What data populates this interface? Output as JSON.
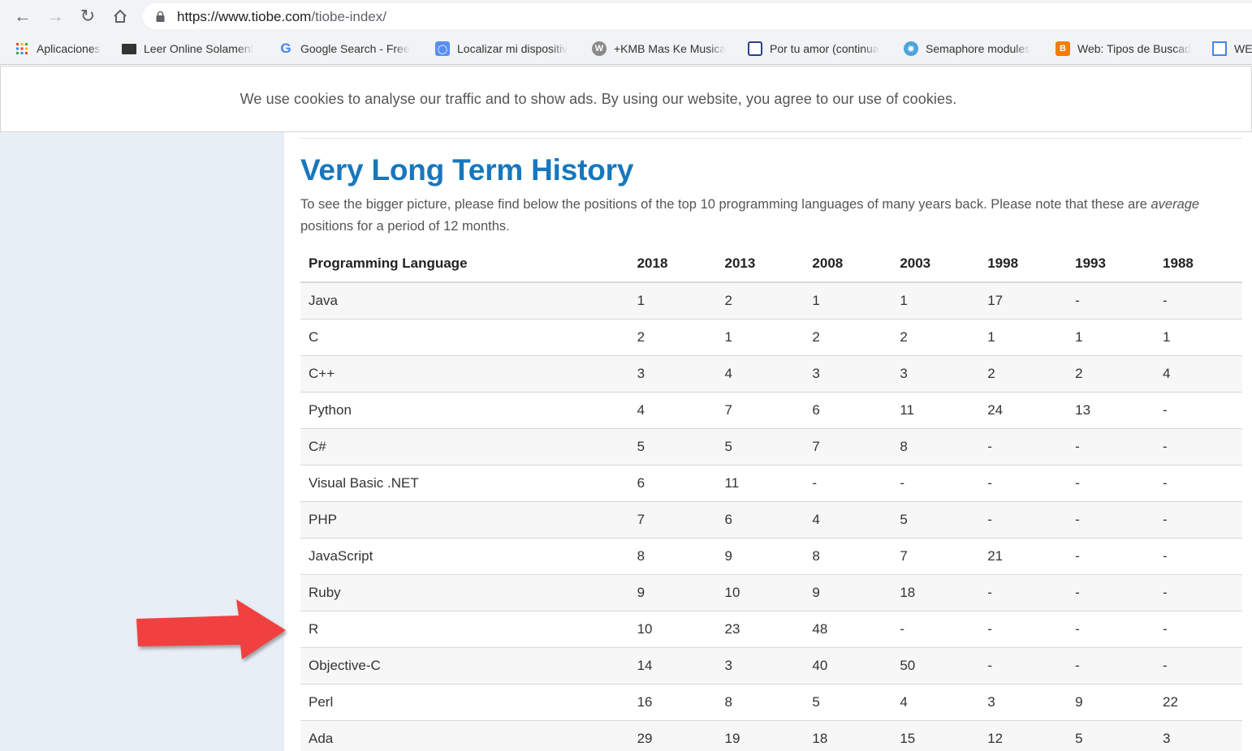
{
  "browser": {
    "url_host": "https://www.tiobe.com",
    "url_path": "/tiobe-index/",
    "bookmarks": [
      {
        "label": "Aplicaciones",
        "icon": "apps-grid-icon"
      },
      {
        "label": "Leer Online Solament",
        "icon": "laptop-icon"
      },
      {
        "label": "Google Search - Free",
        "icon": "google-icon"
      },
      {
        "label": "Localizar mi dispositiv",
        "icon": "find-device-icon"
      },
      {
        "label": "+KMB Mas Ke Musica",
        "icon": "wordpress-icon"
      },
      {
        "label": "Por tu amor (continua",
        "icon": "document-icon"
      },
      {
        "label": "Semaphore modules",
        "icon": "semaphore-icon"
      },
      {
        "label": "Web: Tipos de Buscad",
        "icon": "blogger-icon"
      },
      {
        "label": "WE",
        "icon": "window-icon"
      }
    ]
  },
  "cookie_banner": {
    "text": "We use cookies to analyse our traffic and to show ads. By using our website, you agree to our use of cookies."
  },
  "section": {
    "title": "Very Long Term History",
    "intro_before": "To see the bigger picture, please find below the positions of the top 10 programming languages of many years back. Please note that these are ",
    "intro_em": "average",
    "intro_after": " positions for a period of 12 months."
  },
  "table": {
    "headers": [
      "Programming Language",
      "2018",
      "2013",
      "2008",
      "2003",
      "1998",
      "1993",
      "1988"
    ],
    "rows": [
      [
        "Java",
        "1",
        "2",
        "1",
        "1",
        "17",
        "-",
        "-"
      ],
      [
        "C",
        "2",
        "1",
        "2",
        "2",
        "1",
        "1",
        "1"
      ],
      [
        "C++",
        "3",
        "4",
        "3",
        "3",
        "2",
        "2",
        "4"
      ],
      [
        "Python",
        "4",
        "7",
        "6",
        "11",
        "24",
        "13",
        "-"
      ],
      [
        "C#",
        "5",
        "5",
        "7",
        "8",
        "-",
        "-",
        "-"
      ],
      [
        "Visual Basic .NET",
        "6",
        "11",
        "-",
        "-",
        "-",
        "-",
        "-"
      ],
      [
        "PHP",
        "7",
        "6",
        "4",
        "5",
        "-",
        "-",
        "-"
      ],
      [
        "JavaScript",
        "8",
        "9",
        "8",
        "7",
        "21",
        "-",
        "-"
      ],
      [
        "Ruby",
        "9",
        "10",
        "9",
        "18",
        "-",
        "-",
        "-"
      ],
      [
        "R",
        "10",
        "23",
        "48",
        "-",
        "-",
        "-",
        "-"
      ],
      [
        "Objective-C",
        "14",
        "3",
        "40",
        "50",
        "-",
        "-",
        "-"
      ],
      [
        "Perl",
        "16",
        "8",
        "5",
        "4",
        "3",
        "9",
        "22"
      ],
      [
        "Ada",
        "29",
        "19",
        "18",
        "15",
        "12",
        "5",
        "3"
      ]
    ]
  },
  "colors": {
    "heading": "#1777bd",
    "arrow": "#f04040",
    "left_panel": "#e8eef5"
  },
  "annotation": {
    "arrow_icon": "red-arrow-icon",
    "points_to_row": "R"
  }
}
